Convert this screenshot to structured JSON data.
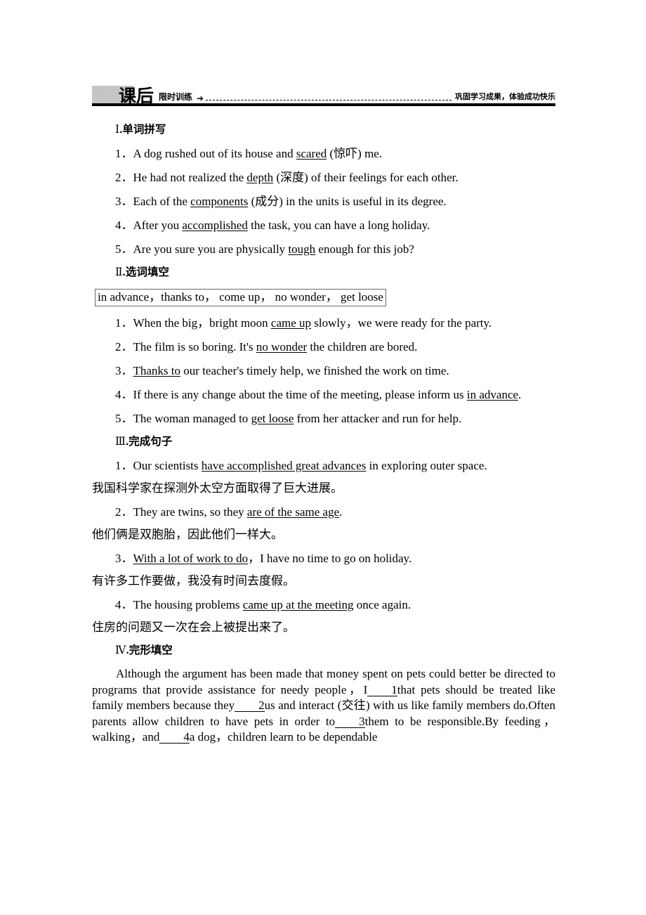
{
  "banner": {
    "title": "课后",
    "subtitle": "限时训练",
    "arrow_icon": "➔",
    "motto": "巩固学习成果，体验成功快乐"
  },
  "sections": [
    {
      "roman": "Ⅰ",
      "heading": ".单词拼写",
      "items": [
        "1．A dog rushed out of its house and scared (惊吓) me.",
        "2．He had not realized the depth (深度) of their feelings for each other.",
        "3．Each of the components (成分) in the units is useful in its degree.",
        "4．After you accomplished the task, you can have a long holiday.",
        "5．Are you sure you are physically tough enough for this job?"
      ]
    },
    {
      "roman": "Ⅱ",
      "heading": ".选词填空",
      "wordbank": "in advance，thanks to，come up，no wonder，get loose",
      "items": [
        "1．When the big，bright moon came up slowly，we were ready for the party.",
        "2．The film is so boring. It's no wonder the children are bored.",
        "3．Thanks to our teacher's timely help, we finished the work on time.",
        "4．If there is any change about the time of the meeting, please inform us in advance.",
        "5．The woman managed to get loose from her attacker and run for help."
      ]
    },
    {
      "roman": "Ⅲ",
      "heading": ".完成句子",
      "items": [
        "1．Our scientists have accomplished great advances in exploring outer space.",
        "我国科学家在探测外太空方面取得了巨大进展。",
        "2．They are twins, so they are of the same age.",
        "他们俩是双胞胎，因此他们一样大。",
        "3．With a lot of work to do，I have no time to go on holiday.",
        "有许多工作要做，我没有时间去度假。",
        "4．The housing problems came up at the meeting once again.",
        "住房的问题又一次在会上被提出来了。"
      ]
    },
    {
      "roman": "Ⅳ",
      "heading": ".完形填空",
      "passage": "Although the argument has been made that money spent on pets could better be directed to programs that provide assistance for needy people，I 1 that pets should be treated like family members because they 2 us and interact (交往) with us like family members do.Often parents allow children to have pets in order to 3 them to be responsible.By feeding，walking，and 4 a dog，children learn to be dependable"
    }
  ],
  "sec1": {
    "roman": "Ⅰ",
    "heading": ".单词拼写",
    "i1": {
      "num": "1．",
      "a": "A dog rushed out of its house and ",
      "ul": "scared",
      "b": " (惊吓) me."
    },
    "i2": {
      "num": "2．",
      "a": "He had not realized the ",
      "ul": "depth",
      "b": " (深度) of their feelings for each other."
    },
    "i3": {
      "num": "3．",
      "a": "Each of the ",
      "ul": "components",
      "b": " (成分) in the units is useful in its degree."
    },
    "i4": {
      "num": "4．",
      "a": "After you ",
      "ul": "accomplished",
      "b": " the task, you can have a long holiday."
    },
    "i5": {
      "num": "5．",
      "a": "Are you sure you are physically ",
      "ul": "tough",
      "b": " enough for this job?"
    }
  },
  "sec2": {
    "roman": "Ⅱ",
    "heading": ".选词填空",
    "wordbank": "in advance，thanks to， come up， no wonder， get loose",
    "i1": {
      "num": "1．",
      "a": "When the big，bright moon ",
      "ul": "came up",
      "b": " slowly，we were ready for the party."
    },
    "i2": {
      "num": "2．",
      "a": "The film is so boring. It's ",
      "ul": "no wonder",
      "b": " the children are bored."
    },
    "i3": {
      "num": "3．",
      "ul": "Thanks to",
      "b": " our teacher's timely help, we finished the work on time."
    },
    "i4": {
      "num": "4．",
      "a": "If there is any change about the time of the meeting, please inform us ",
      "ul": "in advance",
      "b": "."
    },
    "i5": {
      "num": "5．",
      "a": "The woman managed to ",
      "ul": "get loose",
      "b": " from her attacker and run for help."
    }
  },
  "sec3": {
    "roman": "Ⅲ",
    "heading": ".完成句子",
    "i1": {
      "num": "1．",
      "a": "Our scientists ",
      "ul": "have accomplished great advances",
      "b": " in exploring outer space."
    },
    "c1": "我国科学家在探测外太空方面取得了巨大进展。",
    "i2": {
      "num": "2．",
      "a": "They are twins, so they ",
      "ul": "are of the same age",
      "b": "."
    },
    "c2": "他们俩是双胞胎，因此他们一样大。",
    "i3": {
      "num": "3．",
      "ul": "With a lot of work to do",
      "b": "，I have no time to go on holiday."
    },
    "c3": "有许多工作要做，我没有时间去度假。",
    "i4": {
      "num": "4．",
      "a": "The housing problems ",
      "ul": "came up at the meeting",
      "b": " once again."
    },
    "c4": "住房的问题又一次在会上被提出来了。"
  },
  "sec4": {
    "roman": "Ⅳ",
    "heading": ".完形填空",
    "p1": "Although the argument has been made that money spent on pets could better be directed to programs that provide assistance for needy people，I",
    "blank1": "1",
    "p2": "that pets should be treated like family members because they",
    "blank2": "2",
    "p3": "us and interact (交往) with us like family members do.Often parents allow children to have pets in order to",
    "blank3": "3",
    "p4": "them to be responsible.By feeding，walking，and",
    "blank4": "4",
    "p5": "a dog，children learn to be dependable"
  }
}
